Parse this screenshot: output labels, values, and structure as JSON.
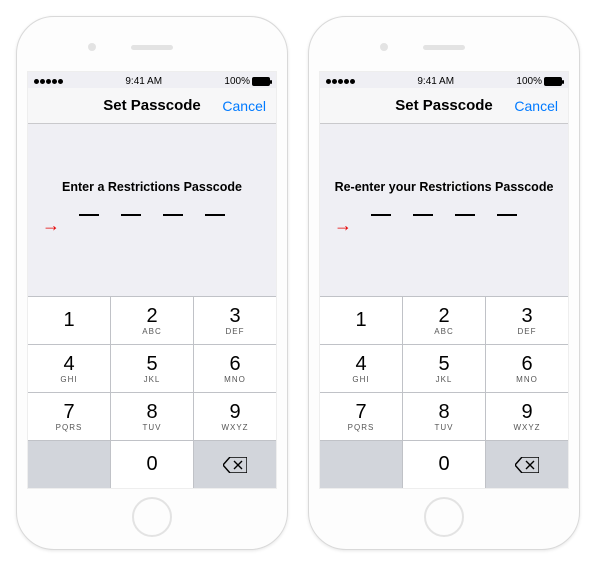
{
  "status": {
    "time": "9:41 AM",
    "battery": "100%"
  },
  "nav": {
    "title": "Set Passcode",
    "cancel": "Cancel"
  },
  "screens": [
    {
      "prompt": "Enter a Restrictions Passcode"
    },
    {
      "prompt": "Re-enter your Restrictions Passcode"
    }
  ],
  "keypad": {
    "rows": [
      [
        {
          "n": "1",
          "l": ""
        },
        {
          "n": "2",
          "l": "ABC"
        },
        {
          "n": "3",
          "l": "DEF"
        }
      ],
      [
        {
          "n": "4",
          "l": "GHI"
        },
        {
          "n": "5",
          "l": "JKL"
        },
        {
          "n": "6",
          "l": "MNO"
        }
      ],
      [
        {
          "n": "7",
          "l": "PQRS"
        },
        {
          "n": "8",
          "l": "TUV"
        },
        {
          "n": "9",
          "l": "WXYZ"
        }
      ],
      [
        {
          "blank": true
        },
        {
          "n": "0",
          "l": ""
        },
        {
          "del": true
        }
      ]
    ]
  }
}
